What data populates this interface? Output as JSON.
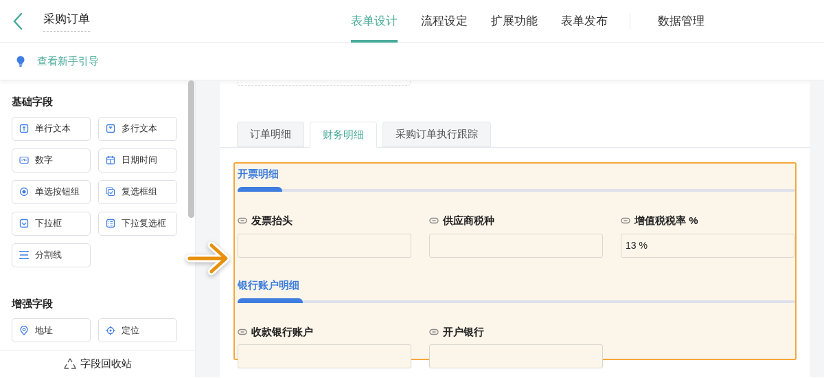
{
  "header": {
    "title": "采购订单",
    "nav": [
      {
        "label": "表单设计",
        "selected": true
      },
      {
        "label": "流程设定",
        "selected": false
      },
      {
        "label": "扩展功能",
        "selected": false
      },
      {
        "label": "表单发布",
        "selected": false
      },
      {
        "label": "数据管理",
        "selected": false,
        "separated": true
      }
    ]
  },
  "guide": {
    "label": "查看新手引导"
  },
  "sidebar": {
    "groups": [
      {
        "title": "基础字段",
        "items": [
          {
            "label": "单行文本",
            "kind": "text"
          },
          {
            "label": "多行文本",
            "kind": "textarea"
          },
          {
            "label": "数字",
            "kind": "number"
          },
          {
            "label": "日期时间",
            "kind": "datetime"
          },
          {
            "label": "单选按钮组",
            "kind": "radio"
          },
          {
            "label": "复选框组",
            "kind": "checkbox"
          },
          {
            "label": "下拉框",
            "kind": "select"
          },
          {
            "label": "下拉复选框",
            "kind": "multiselect"
          },
          {
            "label": "分割线",
            "kind": "divider"
          }
        ]
      },
      {
        "title": "增强字段",
        "items": [
          {
            "label": "地址",
            "kind": "address"
          },
          {
            "label": "定位",
            "kind": "location"
          }
        ]
      }
    ],
    "footer": "字段回收站"
  },
  "tabs": [
    {
      "label": "订单明细",
      "selected": false
    },
    {
      "label": "财务明细",
      "selected": true
    },
    {
      "label": "采购订单执行跟踪",
      "selected": false
    }
  ],
  "sections": [
    {
      "title": "开票明细",
      "fields": [
        {
          "label": "发票抬头"
        },
        {
          "label": "供应商税种"
        },
        {
          "label": "增值税税率 %",
          "value": "13 %"
        }
      ]
    },
    {
      "title": "银行账户明细",
      "fields": [
        {
          "label": "收款银行账户"
        },
        {
          "label": "开户银行"
        }
      ]
    }
  ]
}
